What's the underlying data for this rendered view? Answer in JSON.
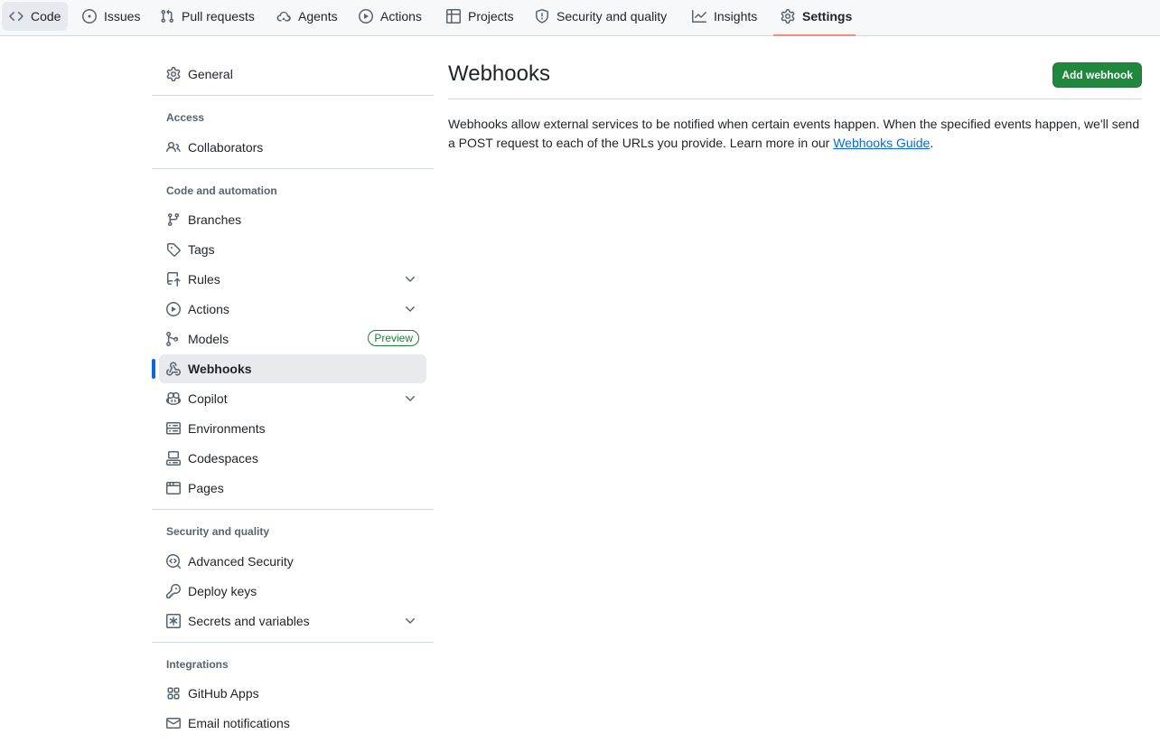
{
  "topnav": {
    "tabs": [
      {
        "label": "Code",
        "icon": "code-icon"
      },
      {
        "label": "Issues",
        "icon": "issue-opened-icon"
      },
      {
        "label": "Pull requests",
        "icon": "git-pull-request-icon"
      },
      {
        "label": "Agents",
        "icon": "agent-cloud-icon"
      },
      {
        "label": "Actions",
        "icon": "play-icon"
      },
      {
        "label": "Projects",
        "icon": "table-icon"
      },
      {
        "label": "Security and quality",
        "icon": "shield-icon"
      },
      {
        "label": "Insights",
        "icon": "graph-icon"
      },
      {
        "label": "Settings",
        "icon": "gear-icon"
      }
    ],
    "selected": "Settings",
    "underline_color": "#fd8c73"
  },
  "sidebar": {
    "general": "General",
    "groups": {
      "access": "Access",
      "code_automation": "Code and automation",
      "security_quality": "Security and quality",
      "integrations": "Integrations"
    },
    "items": {
      "collaborators": "Collaborators",
      "branches": "Branches",
      "tags": "Tags",
      "rules": "Rules",
      "actions": "Actions",
      "models": "Models",
      "models_badge": "Preview",
      "webhooks": "Webhooks",
      "copilot": "Copilot",
      "environments": "Environments",
      "codespaces": "Codespaces",
      "pages": "Pages",
      "advanced_security": "Advanced Security",
      "deploy_keys": "Deploy keys",
      "secrets_variables": "Secrets and variables",
      "github_apps": "GitHub Apps",
      "email_notifications": "Email notifications"
    },
    "current": "Webhooks"
  },
  "main": {
    "title": "Webhooks",
    "add_button": "Add webhook",
    "description_text": "Webhooks allow external services to be notified when certain events happen. When the specified events happen, we'll send a POST request to each of the URLs you provide. Learn more in our ",
    "link_text": "Webhooks Guide",
    "description_end": "."
  },
  "colors": {
    "accent": "#0969da",
    "primary_button": "#1f883d",
    "badge_green": "#1a7f37"
  }
}
